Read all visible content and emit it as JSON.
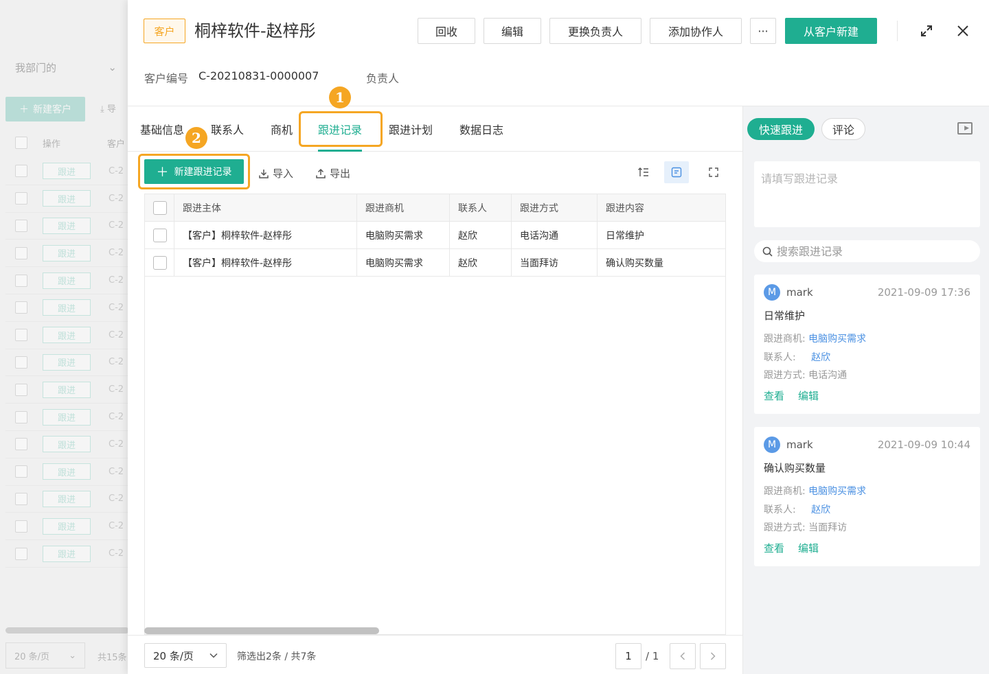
{
  "background": {
    "dept_select": "我部门的",
    "new_button": "新建客户",
    "import_label": "导",
    "col_action": "操作",
    "col_code": "客户",
    "row_tag": "跟进",
    "row_code": "C-2",
    "row_count": 15,
    "page_size": "20 条/页",
    "total": "共15条"
  },
  "header": {
    "tag": "客户",
    "title": "桐梓软件-赵梓彤",
    "buttons": {
      "recycle": "回收",
      "edit": "编辑",
      "change_owner": "更换负责人",
      "add_collaborator": "添加协作人",
      "more": "···",
      "new_from_customer": "从客户新建"
    },
    "customer_no_label": "客户编号",
    "customer_no": "C-20210831-0000007",
    "owner_label": "负责人"
  },
  "tabs": [
    "基础信息",
    "联系人",
    "商机",
    "跟进记录",
    "跟进计划",
    "数据日志"
  ],
  "active_tab": "跟进记录",
  "steps": [
    "1",
    "2"
  ],
  "toolbar": {
    "new_record": "新建跟进记录",
    "import": "导入",
    "export": "导出"
  },
  "table": {
    "columns": [
      "跟进主体",
      "跟进商机",
      "联系人",
      "跟进方式",
      "跟进内容"
    ],
    "rows": [
      [
        "【客户】桐梓软件-赵梓彤",
        "电脑购买需求",
        "赵欣",
        "电话沟通",
        "日常维护"
      ],
      [
        "【客户】桐梓软件-赵梓彤",
        "电脑购买需求",
        "赵欣",
        "当面拜访",
        "确认购买数量"
      ]
    ]
  },
  "footer": {
    "page_size": "20 条/页",
    "filter_info": "筛选出2条 / 共7条",
    "current_page": "1",
    "total_pages": "/ 1"
  },
  "sidebar": {
    "quick_follow": "快速跟进",
    "comment": "评论",
    "input_placeholder": "请填写跟进记录",
    "search_placeholder": "搜索跟进记录",
    "cards": [
      {
        "avatar": "M",
        "user": "mark",
        "time": "2021-09-09 17:36",
        "content": "日常维护",
        "opportunity_label": "跟进商机:",
        "opportunity": "电脑购买需求",
        "contact_label": "联系人:",
        "contact": "赵欣",
        "method_label": "跟进方式:",
        "method": "电话沟通",
        "view": "查看",
        "edit": "编辑"
      },
      {
        "avatar": "M",
        "user": "mark",
        "time": "2021-09-09 10:44",
        "content": "确认购买数量",
        "opportunity_label": "跟进商机:",
        "opportunity": "电脑购买需求",
        "contact_label": "联系人:",
        "contact": "赵欣",
        "method_label": "跟进方式:",
        "method": "当面拜访",
        "view": "查看",
        "edit": "编辑"
      }
    ]
  },
  "colors": {
    "primary": "#1fae91",
    "highlight": "#f5a623",
    "link": "#4a90e2"
  }
}
